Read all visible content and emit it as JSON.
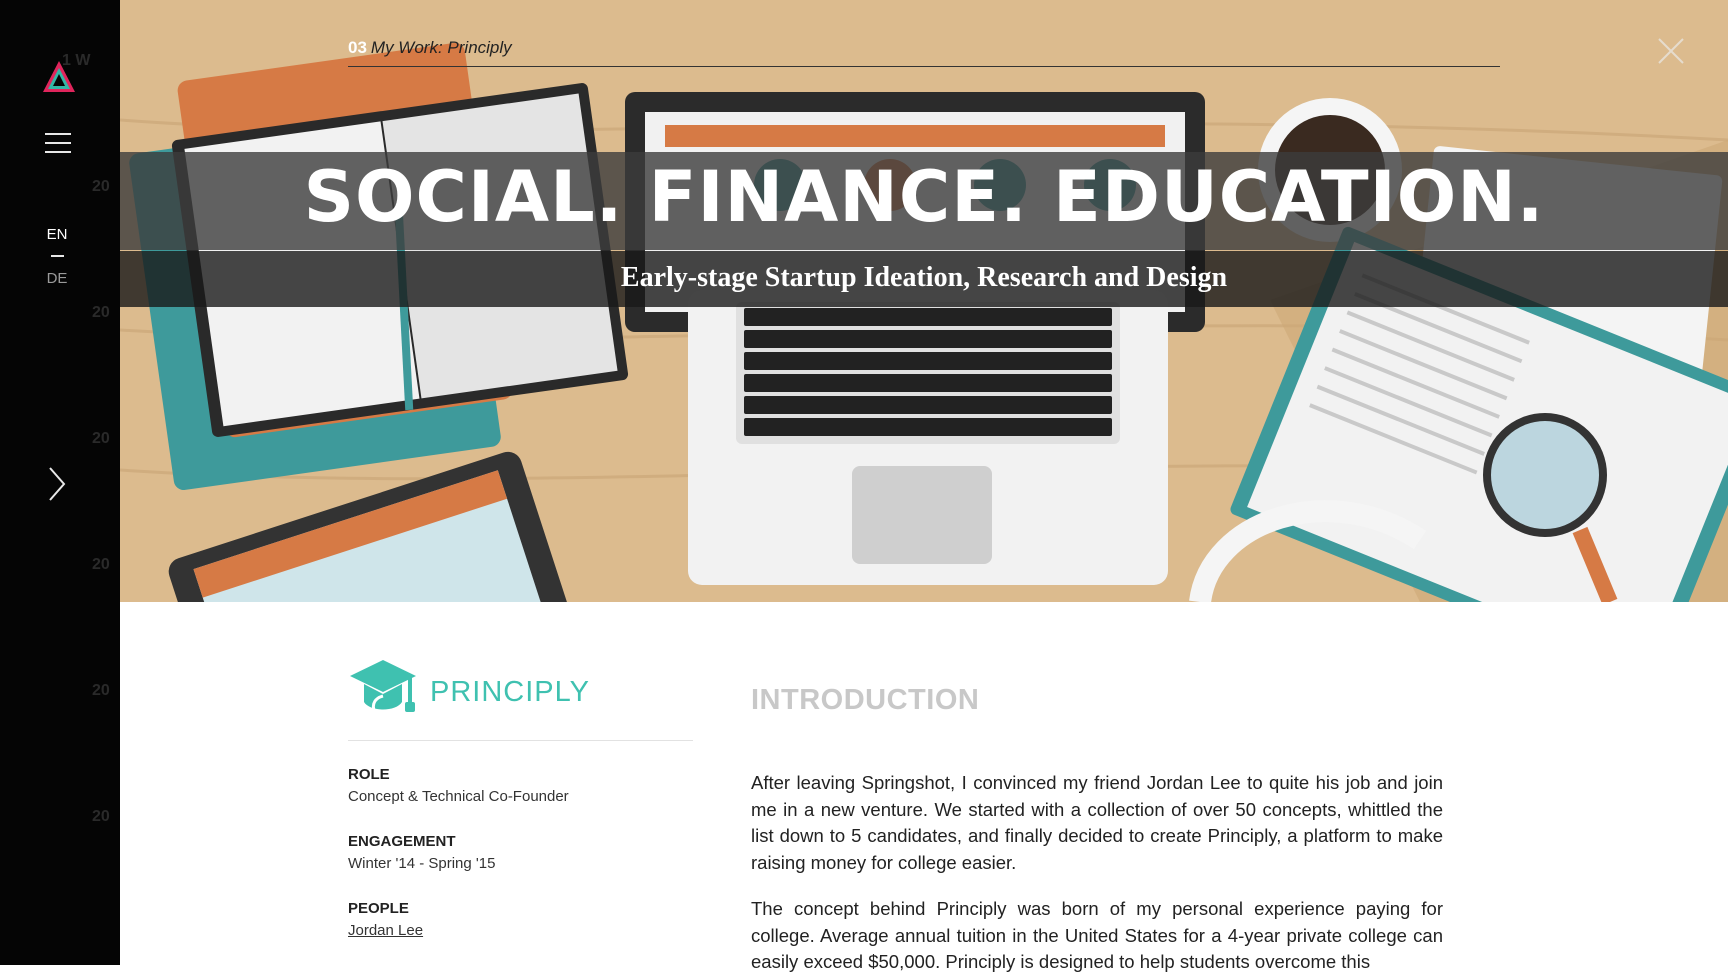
{
  "sidebar": {
    "lang_en": "EN",
    "lang_de": "DE",
    "menu_icon": "hamburger-menu-icon",
    "logo_icon": "triangle-logo-icon",
    "next_icon": "chevron-right-icon"
  },
  "breadcrumb": {
    "number": "03",
    "text": "My Work: Principly"
  },
  "hero": {
    "title": "SOCIAL. FINANCE. EDUCATION.",
    "subtitle": "Early-stage Startup Ideation, Research and Design"
  },
  "project": {
    "name": "PRINCIPLY",
    "icon": "graduation-cap-icon",
    "brand_color": "#3fc1b0",
    "role_label": "ROLE",
    "role_value": "Concept & Technical Co-Founder",
    "engagement_label": "ENGAGEMENT",
    "engagement_value": "Winter '14 - Spring '15",
    "people_label": "PEOPLE",
    "people_value": "Jordan Lee"
  },
  "intro": {
    "heading": "INTRODUCTION",
    "paragraph1": "After leaving Springshot, I convinced my friend Jordan Lee to quite his job and join me in a new venture. We started with a collection of over 50 concepts, whittled the list down to 5 candidates, and finally decided to create Principly, a platform to make raising money for college easier.",
    "paragraph2": "The concept behind Principly was born of my personal experience paying for college. Average annual tuition in the United States for a 4-year private college can easily exceed $50,000. Principly is designed to help students overcome this"
  }
}
